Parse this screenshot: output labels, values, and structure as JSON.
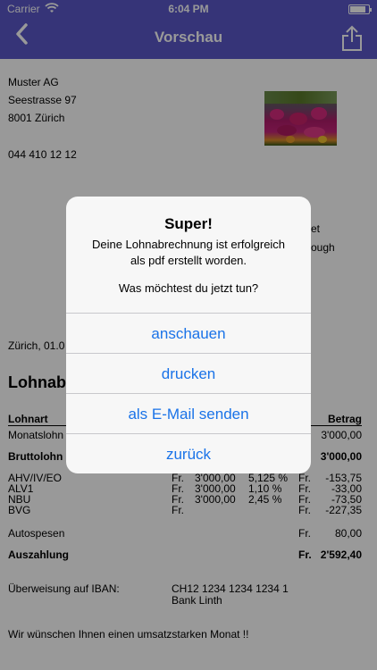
{
  "status_bar": {
    "carrier": "Carrier",
    "time": "6:04 PM",
    "battery_level": 0.85
  },
  "nav": {
    "title": "Vorschau",
    "back_icon": "chevron-left-icon",
    "share_icon": "share-icon"
  },
  "document": {
    "company": "Muster AG",
    "street": "Seestrasse 97",
    "city": "8001 Zürich",
    "phone": "044 410 12 12",
    "address_right_1": "et",
    "address_right_2": "ough",
    "date_partial": "Zürich, 01.0",
    "heading_partial": "Lohnab",
    "table_header": {
      "col1": "Lohnart",
      "col_amount": "Betrag"
    },
    "rows": [
      {
        "label": "Monatslohn",
        "amount": "3'000,00"
      },
      {
        "label": "Bruttolohn",
        "amount": "3'000,00"
      }
    ],
    "deductions": [
      {
        "label": "AHV/IV/EO",
        "fr1": "Fr.",
        "base": "3'000,00",
        "rate": "5,125 %",
        "fr2": "Fr.",
        "amount": "-153,75"
      },
      {
        "label": "ALV1",
        "fr1": "Fr.",
        "base": "3'000,00",
        "rate": "1,10 %",
        "fr2": "Fr.",
        "amount": "-33,00"
      },
      {
        "label": "NBU",
        "fr1": "Fr.",
        "base": "3'000,00",
        "rate": "2,45 %",
        "fr2": "Fr.",
        "amount": "-73,50"
      },
      {
        "label": "BVG",
        "fr1": "Fr.",
        "base": "",
        "rate": "",
        "fr2": "Fr.",
        "amount": "-227,35"
      }
    ],
    "autospesen": {
      "label": "Autospesen",
      "fr": "Fr.",
      "amount": "80,00"
    },
    "auszahlung": {
      "label": "Auszahlung",
      "fr": "Fr.",
      "amount": "2'592,40"
    },
    "iban_label": "Überweisung auf IBAN:",
    "iban_value": "CH12 1234 1234 1234 1",
    "bank": "Bank Linth",
    "closing": "Wir wünschen Ihnen einen umsatzstarken Monat !!"
  },
  "alert": {
    "title": "Super!",
    "message_line1": "Deine Lohnabrechnung ist erfolgreich",
    "message_line2": "als pdf erstellt worden.",
    "question": "Was möchtest du jetzt tun?",
    "buttons": [
      "anschauen",
      "drucken",
      "als E-Mail senden",
      "zurück"
    ]
  }
}
